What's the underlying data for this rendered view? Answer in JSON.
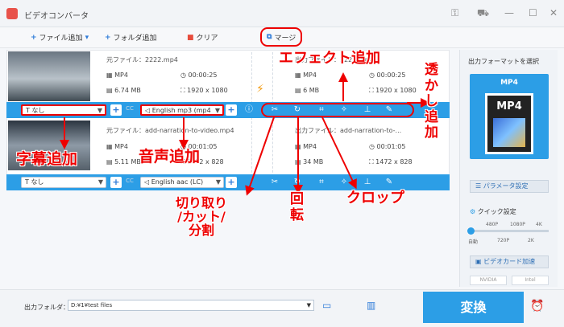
{
  "app": {
    "title": "ビデオコンバータ"
  },
  "toolbar": {
    "add_file": "ファイル追加",
    "add_folder": "フォルダ追加",
    "clear": "クリア",
    "merge": "マージ"
  },
  "file1": {
    "source_label": "元ファイル：2222.mp4",
    "format": "MP4",
    "duration": "00:00:25",
    "size": "6.74 MB",
    "resolution": "1920 x 1080",
    "output_label": "出力ファイル：2222.mp4",
    "out_format": "MP4",
    "out_duration": "00:00:25",
    "out_size": "6 MB",
    "out_resolution": "1920 x 1080"
  },
  "file2": {
    "source_label": "元ファイル：add-narration-to-video.mp4",
    "format": "MP4",
    "duration": "00:01:05",
    "size": "5.11 MB",
    "resolution": "1472 x 828",
    "output_label": "出力ファイル：add-narration-to-...",
    "out_format": "MP4",
    "out_duration": "00:01:05",
    "out_size": "34 MB",
    "out_resolution": "1472 x 828"
  },
  "bar1": {
    "subtitle": "なし",
    "audio": "English mp3 (mp4",
    "cc": "CC"
  },
  "bar2": {
    "subtitle": "なし",
    "audio": "English aac (LC)",
    "cc": "CC"
  },
  "right": {
    "format_heading": "出力フォーマットを選択",
    "format_name": "MP4",
    "format_icon_text": "MP4",
    "param_button": "パラメータ設定",
    "quick_label": "クイック設定",
    "ticks_top": [
      "480P",
      "1080P",
      "4K"
    ],
    "ticks_bottom": [
      "自動",
      "720P",
      "2K"
    ],
    "gpu_button": "ビデオカード加速",
    "gpu_vendors": [
      "NVIDIA",
      "Intel"
    ]
  },
  "bottom": {
    "output_folder_label": "出力フォルダ：",
    "output_folder_value": "D:¥1¥test files",
    "convert": "変換"
  },
  "annotations": {
    "subtitle_add": "字幕追加",
    "audio_add": "音声追加",
    "effect_add": "エフェクト追加",
    "watermark_add": "透かし追加",
    "cut": "切り取り\n/カット/\n分割",
    "rotate": "回転",
    "crop": "クロップ"
  },
  "colors": {
    "accent": "#2c9ee6",
    "annotation": "#e00000"
  }
}
